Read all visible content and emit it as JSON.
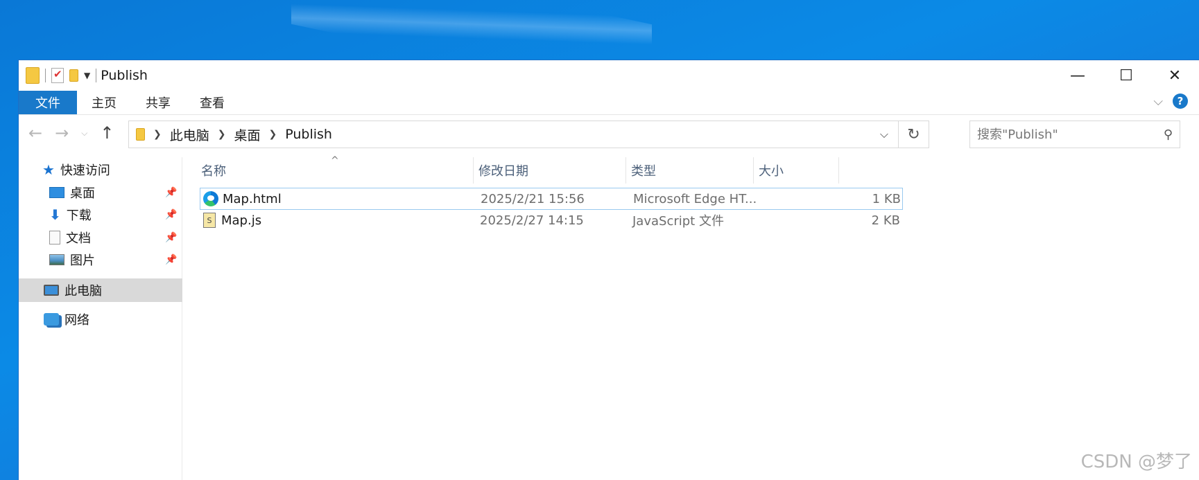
{
  "window": {
    "title": "Publish",
    "controls": {
      "minimize": "—",
      "maximize": "☐",
      "close": "✕"
    }
  },
  "ribbon": {
    "tabs": [
      {
        "label": "文件"
      },
      {
        "label": "主页"
      },
      {
        "label": "共享"
      },
      {
        "label": "查看"
      }
    ],
    "help": "?"
  },
  "address": {
    "crumbs": [
      "此电脑",
      "桌面",
      "Publish"
    ]
  },
  "search": {
    "placeholder": "搜索\"Publish\""
  },
  "navpane": {
    "quick_access": "快速访问",
    "items": [
      {
        "label": "桌面"
      },
      {
        "label": "下载"
      },
      {
        "label": "文档"
      },
      {
        "label": "图片"
      }
    ],
    "this_pc": "此电脑",
    "network": "网络"
  },
  "columns": {
    "name": "名称",
    "date": "修改日期",
    "type": "类型",
    "size": "大小"
  },
  "files": [
    {
      "name": "Map.html",
      "date": "2025/2/21 15:56",
      "type": "Microsoft Edge HT...",
      "size": "1 KB",
      "icon": "edge-icon"
    },
    {
      "name": "Map.js",
      "date": "2025/2/27 14:15",
      "type": "JavaScript 文件",
      "size": "2 KB",
      "icon": "javascript-file-icon"
    }
  ],
  "watermark": "CSDN @梦了"
}
